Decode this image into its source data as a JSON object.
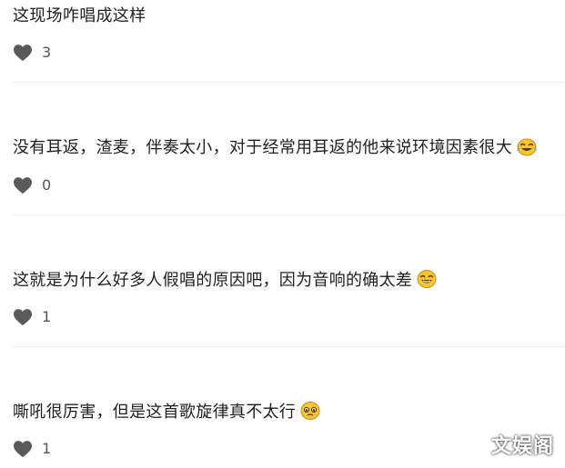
{
  "comments": [
    {
      "text": "这现场咋唱成这样",
      "likes": "3",
      "emoji": ""
    },
    {
      "text": "没有耳返，渣麦，伴奏太小，对于经常用耳返的他来说环境因素很大",
      "likes": "0",
      "emoji": "laughing-crying-emoji"
    },
    {
      "text": "这就是为什么好多人假唱的原因吧，因为音响的确太差",
      "likes": "1",
      "emoji": "laughing-emoji"
    },
    {
      "text": "嘶吼很厉害，但是这首歌旋律真不太行",
      "likes": "1",
      "emoji": "pleading-emoji"
    }
  ],
  "watermark": {
    "text": "文娱阁"
  },
  "colors": {
    "heart": "#5a5a5a",
    "divider": "#ececec",
    "text": "#1f1f1f"
  }
}
